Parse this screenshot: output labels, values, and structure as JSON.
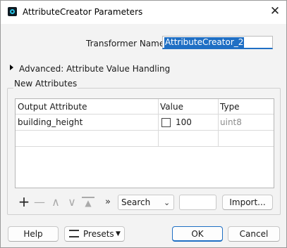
{
  "window": {
    "title": "AttributeCreator Parameters",
    "close_glyph": "✕"
  },
  "transformer": {
    "label": "Transformer Name:",
    "value": "AttributeCreator_2"
  },
  "advanced": {
    "label": "Advanced: Attribute Value Handling"
  },
  "new_attributes": {
    "group_label": "New Attributes",
    "columns": [
      "Output Attribute",
      "Value",
      "Type"
    ],
    "rows": [
      {
        "attribute": "building_height",
        "value": "100",
        "type": "uint8",
        "checked": false
      }
    ]
  },
  "toolbar": {
    "add_glyph": "+",
    "remove_glyph": "—",
    "up_glyph": "∧",
    "down_glyph": "∨",
    "top_glyph": "▲",
    "more_glyph": "»",
    "search_value": "Search",
    "import_label": "Import..."
  },
  "footer": {
    "help_label": "Help",
    "presets_label": "Presets",
    "ok_label": "OK",
    "cancel_label": "Cancel"
  },
  "colors": {
    "accent": "#1f6fc4",
    "app_icon": "#27c3e6"
  }
}
